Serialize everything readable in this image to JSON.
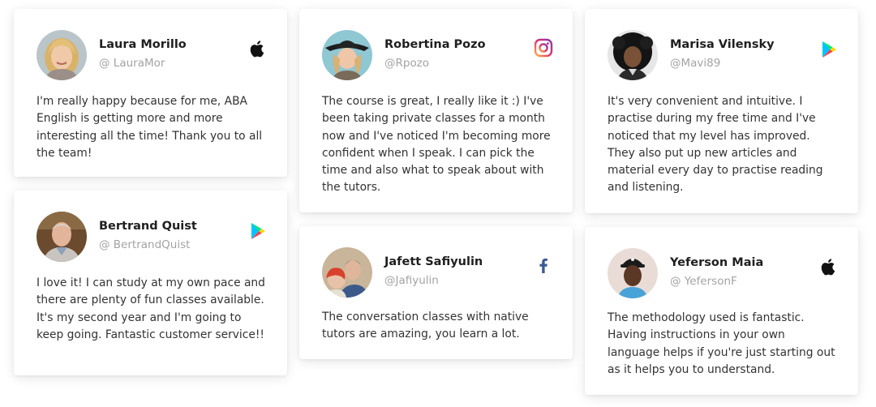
{
  "testimonials": [
    {
      "name": "Laura Morillo",
      "handle": "@ LauraMor",
      "platform_icon": "apple-icon",
      "text": "I'm really happy because for me, ABA English is getting more and more interesting all the time! Thank you to all the team!"
    },
    {
      "name": "Bertrand Quist",
      "handle": "@ BertrandQuist",
      "platform_icon": "google-play-icon",
      "text": "I love it! I can study at my own pace and there are plenty of fun classes available. It's my second year and I'm going to keep going. Fantastic customer service!!"
    },
    {
      "name": "Robertina Pozo",
      "handle": "@Rpozo",
      "platform_icon": "instagram-icon",
      "text": "The course is great, I really like it :) I've been taking private classes for a month now and I've noticed I'm becoming more confident when I speak. I can pick the time and also what to speak about with the tutors."
    },
    {
      "name": "Jafett Safiyulin",
      "handle": "@Jafiyulin",
      "platform_icon": "facebook-icon",
      "text": "The conversation classes with native tutors are amazing, you learn a lot."
    },
    {
      "name": "Marisa Vilensky",
      "handle": "@Mavi89",
      "platform_icon": "google-play-icon",
      "text": "It's very convenient and intuitive. I practise during my free time and I've noticed that my level has improved. They also put up new articles and material every day to practise reading and listening."
    },
    {
      "name": "Yeferson Maia",
      "handle": "@ YefersonF",
      "platform_icon": "apple-icon",
      "text": "The methodology used is fantastic. Having instructions in your own language  helps if you're just starting out as it helps you to understand."
    }
  ],
  "colors": {
    "instagram": "#c13584",
    "facebook": "#3b5998",
    "apple": "#111111",
    "handle": "#a3a3a3"
  }
}
